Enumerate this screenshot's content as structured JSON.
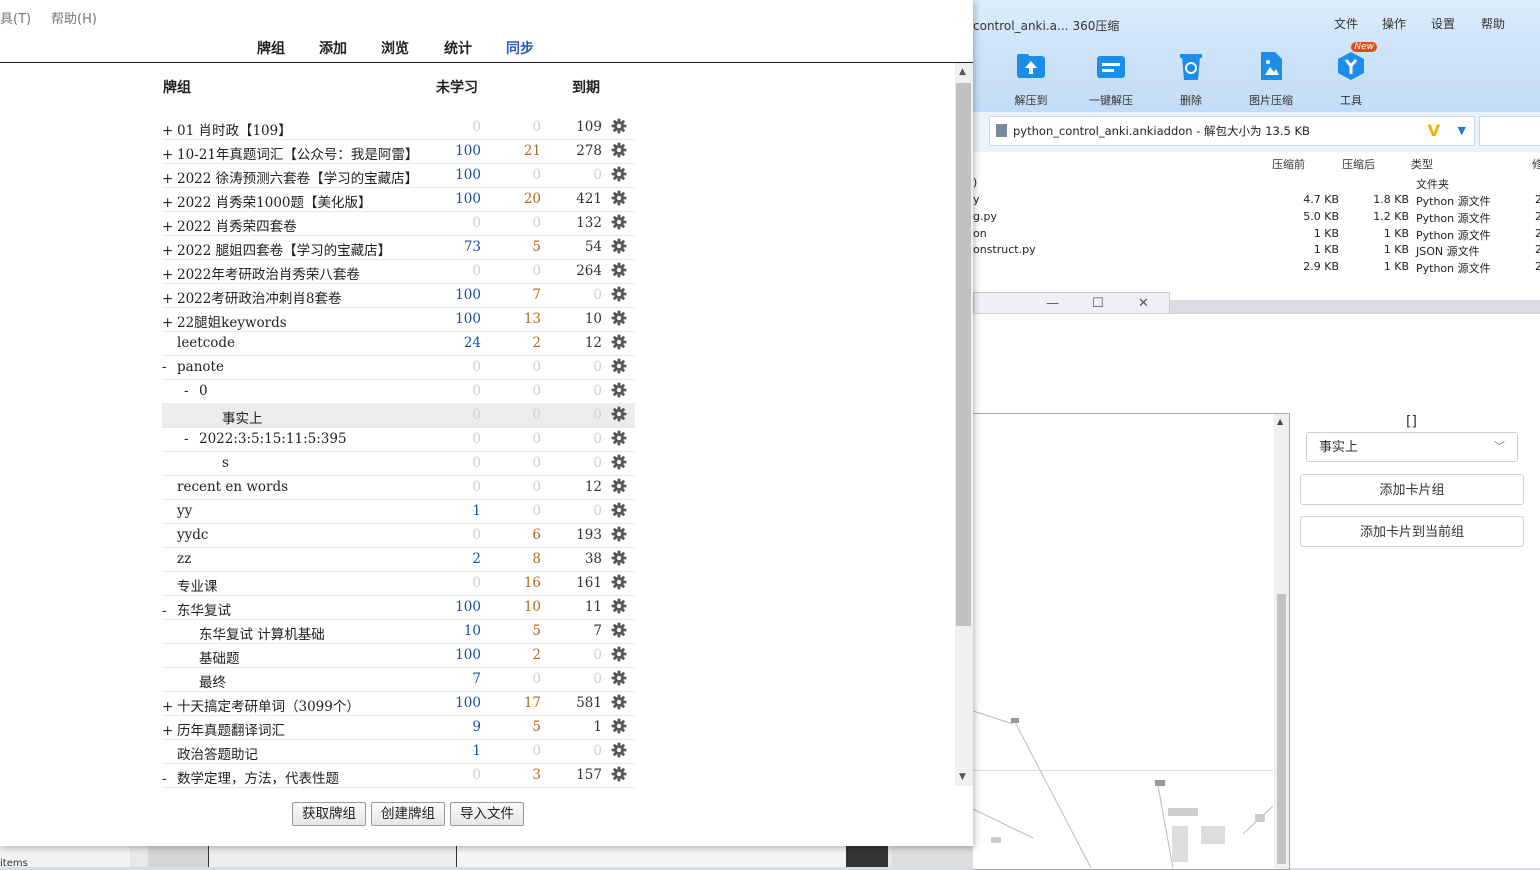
{
  "zip": {
    "title": "control_anki.a...",
    "subtitle": "360压缩",
    "menu": [
      "文件",
      "操作",
      "设置",
      "帮助"
    ],
    "tools": [
      {
        "label": "解压到",
        "icon": "extract-icon"
      },
      {
        "label": "一键解压",
        "icon": "one-click-extract-icon"
      },
      {
        "label": "删除",
        "icon": "delete-icon"
      },
      {
        "label": "图片压缩",
        "icon": "image-compress-icon"
      },
      {
        "label": "工具",
        "icon": "tools-icon",
        "badge": "New"
      }
    ],
    "address": "python_control_anki.ankiaddon - 解包大小为 13.5 KB",
    "columns": [
      "压缩前",
      "压缩后",
      "类型",
      "修"
    ],
    "files": [
      {
        "name": ")",
        "before": "",
        "after": "",
        "type": "文件夹",
        "m": ""
      },
      {
        "name": "y",
        "before": "4.7 KB",
        "after": "1.8 KB",
        "type": "Python 源文件",
        "m": "2"
      },
      {
        "name": "g.py",
        "before": "5.0 KB",
        "after": "1.2 KB",
        "type": "Python 源文件",
        "m": "2"
      },
      {
        "name": "on",
        "before": "1 KB",
        "after": "1 KB",
        "type": "Python 源文件",
        "m": "2"
      },
      {
        "name": "onstruct.py",
        "before": "1 KB",
        "after": "1 KB",
        "type": "JSON 源文件",
        "m": "2"
      },
      {
        "name": "",
        "before": "2.9 KB",
        "after": "1 KB",
        "type": "Python 源文件",
        "m": "2"
      }
    ]
  },
  "editor": {
    "bracket": "[]",
    "select_value": "事实上",
    "add_group_button": "添加卡片组",
    "add_card_button": "添加卡片到当前组"
  },
  "taskbar": {
    "left_text": "items"
  },
  "anki": {
    "menu": {
      "tools": "具(T)",
      "help": "帮助(H)"
    },
    "toolbar": {
      "decks": "牌组",
      "add": "添加",
      "browse": "浏览",
      "stats": "统计",
      "sync": "同步"
    },
    "headers": {
      "deck": "牌组",
      "new": "未学习",
      "due": "到期"
    },
    "decks": [
      {
        "toggle": "+",
        "name": "01 肖时政【109】",
        "indent": 0,
        "new": "0",
        "learn": "0",
        "due": "109"
      },
      {
        "toggle": "+",
        "name": "10-21年真题词汇【公众号：我是阿雷】",
        "indent": 0,
        "new": "100",
        "learn": "21",
        "due": "278"
      },
      {
        "toggle": "+",
        "name": "2022 徐涛预测六套卷【学习的宝藏店】",
        "indent": 0,
        "new": "100",
        "learn": "0",
        "due": "0"
      },
      {
        "toggle": "+",
        "name": "2022 肖秀荣1000题【美化版】",
        "indent": 0,
        "new": "100",
        "learn": "20",
        "due": "421"
      },
      {
        "toggle": "+",
        "name": "2022 肖秀荣四套卷",
        "indent": 0,
        "new": "0",
        "learn": "0",
        "due": "132"
      },
      {
        "toggle": "+",
        "name": "2022 腿姐四套卷【学习的宝藏店】",
        "indent": 0,
        "new": "73",
        "learn": "5",
        "due": "54"
      },
      {
        "toggle": "+",
        "name": "2022年考研政治肖秀荣八套卷",
        "indent": 0,
        "new": "0",
        "learn": "0",
        "due": "264"
      },
      {
        "toggle": "+",
        "name": "2022考研政治冲刺肖8套卷",
        "indent": 0,
        "new": "100",
        "learn": "7",
        "due": "0"
      },
      {
        "toggle": "+",
        "name": "22腿姐keywords",
        "indent": 0,
        "new": "100",
        "learn": "13",
        "due": "10"
      },
      {
        "toggle": "",
        "name": "leetcode",
        "indent": 0,
        "new": "24",
        "learn": "2",
        "due": "12"
      },
      {
        "toggle": "-",
        "name": "panote",
        "indent": 0,
        "new": "0",
        "learn": "0",
        "due": "0"
      },
      {
        "toggle": "-",
        "name": "0",
        "indent": 1,
        "new": "0",
        "learn": "0",
        "due": "0"
      },
      {
        "toggle": "",
        "name": "事实上",
        "indent": 2,
        "new": "0",
        "learn": "0",
        "due": "0",
        "current": true
      },
      {
        "toggle": "-",
        "name": "2022:3:5:15:11:5:395",
        "indent": 1,
        "new": "0",
        "learn": "0",
        "due": "0"
      },
      {
        "toggle": "",
        "name": "s",
        "indent": 2,
        "new": "0",
        "learn": "0",
        "due": "0"
      },
      {
        "toggle": "",
        "name": "recent en words",
        "indent": 0,
        "new": "0",
        "learn": "0",
        "due": "12"
      },
      {
        "toggle": "",
        "name": "yy",
        "indent": 0,
        "new": "1",
        "learn": "0",
        "due": "0"
      },
      {
        "toggle": "",
        "name": "yydc",
        "indent": 0,
        "new": "0",
        "learn": "6",
        "due": "193"
      },
      {
        "toggle": "",
        "name": "zz",
        "indent": 0,
        "new": "2",
        "learn": "8",
        "due": "38"
      },
      {
        "toggle": "",
        "name": "专业课",
        "indent": 0,
        "new": "0",
        "learn": "16",
        "due": "161"
      },
      {
        "toggle": "-",
        "name": "东华复试",
        "indent": 0,
        "new": "100",
        "learn": "10",
        "due": "11"
      },
      {
        "toggle": "",
        "name": "东华复试 计算机基础",
        "indent": 1,
        "new": "10",
        "learn": "5",
        "due": "7"
      },
      {
        "toggle": "",
        "name": "基础题",
        "indent": 1,
        "new": "100",
        "learn": "2",
        "due": "0"
      },
      {
        "toggle": "",
        "name": "最终",
        "indent": 1,
        "new": "7",
        "learn": "0",
        "due": "0"
      },
      {
        "toggle": "+",
        "name": "十天搞定考研单词（3099个）",
        "indent": 0,
        "new": "100",
        "learn": "17",
        "due": "581"
      },
      {
        "toggle": "+",
        "name": "历年真题翻译词汇",
        "indent": 0,
        "new": "9",
        "learn": "5",
        "due": "1"
      },
      {
        "toggle": "",
        "name": "政治答题助记",
        "indent": 0,
        "new": "1",
        "learn": "0",
        "due": "0"
      },
      {
        "toggle": "-",
        "name": "数学定理，方法，代表性题",
        "indent": 0,
        "new": "0",
        "learn": "3",
        "due": "157"
      }
    ],
    "buttons": {
      "get_shared": "获取牌组",
      "create": "创建牌组",
      "import": "导入文件"
    }
  }
}
